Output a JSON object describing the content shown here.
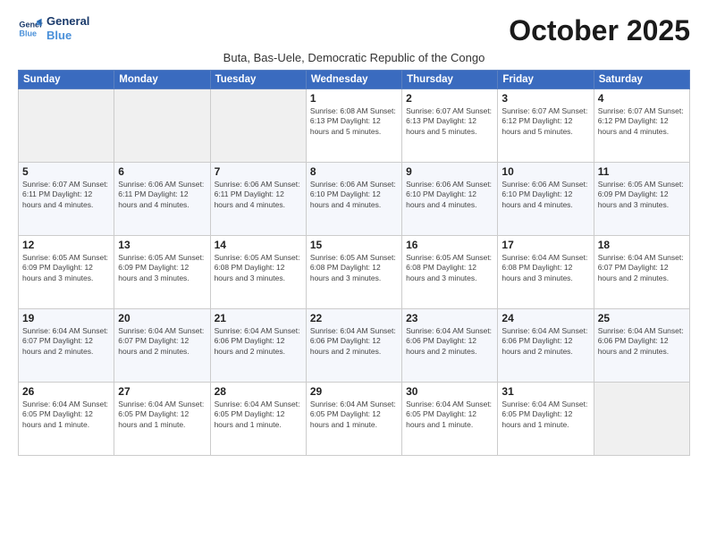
{
  "logo": {
    "line1": "General",
    "line2": "Blue"
  },
  "title": "October 2025",
  "subtitle": "Buta, Bas-Uele, Democratic Republic of the Congo",
  "days_of_week": [
    "Sunday",
    "Monday",
    "Tuesday",
    "Wednesday",
    "Thursday",
    "Friday",
    "Saturday"
  ],
  "weeks": [
    [
      {
        "day": "",
        "info": ""
      },
      {
        "day": "",
        "info": ""
      },
      {
        "day": "",
        "info": ""
      },
      {
        "day": "1",
        "info": "Sunrise: 6:08 AM\nSunset: 6:13 PM\nDaylight: 12 hours\nand 5 minutes."
      },
      {
        "day": "2",
        "info": "Sunrise: 6:07 AM\nSunset: 6:13 PM\nDaylight: 12 hours\nand 5 minutes."
      },
      {
        "day": "3",
        "info": "Sunrise: 6:07 AM\nSunset: 6:12 PM\nDaylight: 12 hours\nand 5 minutes."
      },
      {
        "day": "4",
        "info": "Sunrise: 6:07 AM\nSunset: 6:12 PM\nDaylight: 12 hours\nand 4 minutes."
      }
    ],
    [
      {
        "day": "5",
        "info": "Sunrise: 6:07 AM\nSunset: 6:11 PM\nDaylight: 12 hours\nand 4 minutes."
      },
      {
        "day": "6",
        "info": "Sunrise: 6:06 AM\nSunset: 6:11 PM\nDaylight: 12 hours\nand 4 minutes."
      },
      {
        "day": "7",
        "info": "Sunrise: 6:06 AM\nSunset: 6:11 PM\nDaylight: 12 hours\nand 4 minutes."
      },
      {
        "day": "8",
        "info": "Sunrise: 6:06 AM\nSunset: 6:10 PM\nDaylight: 12 hours\nand 4 minutes."
      },
      {
        "day": "9",
        "info": "Sunrise: 6:06 AM\nSunset: 6:10 PM\nDaylight: 12 hours\nand 4 minutes."
      },
      {
        "day": "10",
        "info": "Sunrise: 6:06 AM\nSunset: 6:10 PM\nDaylight: 12 hours\nand 4 minutes."
      },
      {
        "day": "11",
        "info": "Sunrise: 6:05 AM\nSunset: 6:09 PM\nDaylight: 12 hours\nand 3 minutes."
      }
    ],
    [
      {
        "day": "12",
        "info": "Sunrise: 6:05 AM\nSunset: 6:09 PM\nDaylight: 12 hours\nand 3 minutes."
      },
      {
        "day": "13",
        "info": "Sunrise: 6:05 AM\nSunset: 6:09 PM\nDaylight: 12 hours\nand 3 minutes."
      },
      {
        "day": "14",
        "info": "Sunrise: 6:05 AM\nSunset: 6:08 PM\nDaylight: 12 hours\nand 3 minutes."
      },
      {
        "day": "15",
        "info": "Sunrise: 6:05 AM\nSunset: 6:08 PM\nDaylight: 12 hours\nand 3 minutes."
      },
      {
        "day": "16",
        "info": "Sunrise: 6:05 AM\nSunset: 6:08 PM\nDaylight: 12 hours\nand 3 minutes."
      },
      {
        "day": "17",
        "info": "Sunrise: 6:04 AM\nSunset: 6:08 PM\nDaylight: 12 hours\nand 3 minutes."
      },
      {
        "day": "18",
        "info": "Sunrise: 6:04 AM\nSunset: 6:07 PM\nDaylight: 12 hours\nand 2 minutes."
      }
    ],
    [
      {
        "day": "19",
        "info": "Sunrise: 6:04 AM\nSunset: 6:07 PM\nDaylight: 12 hours\nand 2 minutes."
      },
      {
        "day": "20",
        "info": "Sunrise: 6:04 AM\nSunset: 6:07 PM\nDaylight: 12 hours\nand 2 minutes."
      },
      {
        "day": "21",
        "info": "Sunrise: 6:04 AM\nSunset: 6:06 PM\nDaylight: 12 hours\nand 2 minutes."
      },
      {
        "day": "22",
        "info": "Sunrise: 6:04 AM\nSunset: 6:06 PM\nDaylight: 12 hours\nand 2 minutes."
      },
      {
        "day": "23",
        "info": "Sunrise: 6:04 AM\nSunset: 6:06 PM\nDaylight: 12 hours\nand 2 minutes."
      },
      {
        "day": "24",
        "info": "Sunrise: 6:04 AM\nSunset: 6:06 PM\nDaylight: 12 hours\nand 2 minutes."
      },
      {
        "day": "25",
        "info": "Sunrise: 6:04 AM\nSunset: 6:06 PM\nDaylight: 12 hours\nand 2 minutes."
      }
    ],
    [
      {
        "day": "26",
        "info": "Sunrise: 6:04 AM\nSunset: 6:05 PM\nDaylight: 12 hours\nand 1 minute."
      },
      {
        "day": "27",
        "info": "Sunrise: 6:04 AM\nSunset: 6:05 PM\nDaylight: 12 hours\nand 1 minute."
      },
      {
        "day": "28",
        "info": "Sunrise: 6:04 AM\nSunset: 6:05 PM\nDaylight: 12 hours\nand 1 minute."
      },
      {
        "day": "29",
        "info": "Sunrise: 6:04 AM\nSunset: 6:05 PM\nDaylight: 12 hours\nand 1 minute."
      },
      {
        "day": "30",
        "info": "Sunrise: 6:04 AM\nSunset: 6:05 PM\nDaylight: 12 hours\nand 1 minute."
      },
      {
        "day": "31",
        "info": "Sunrise: 6:04 AM\nSunset: 6:05 PM\nDaylight: 12 hours\nand 1 minute."
      },
      {
        "day": "",
        "info": ""
      }
    ]
  ]
}
